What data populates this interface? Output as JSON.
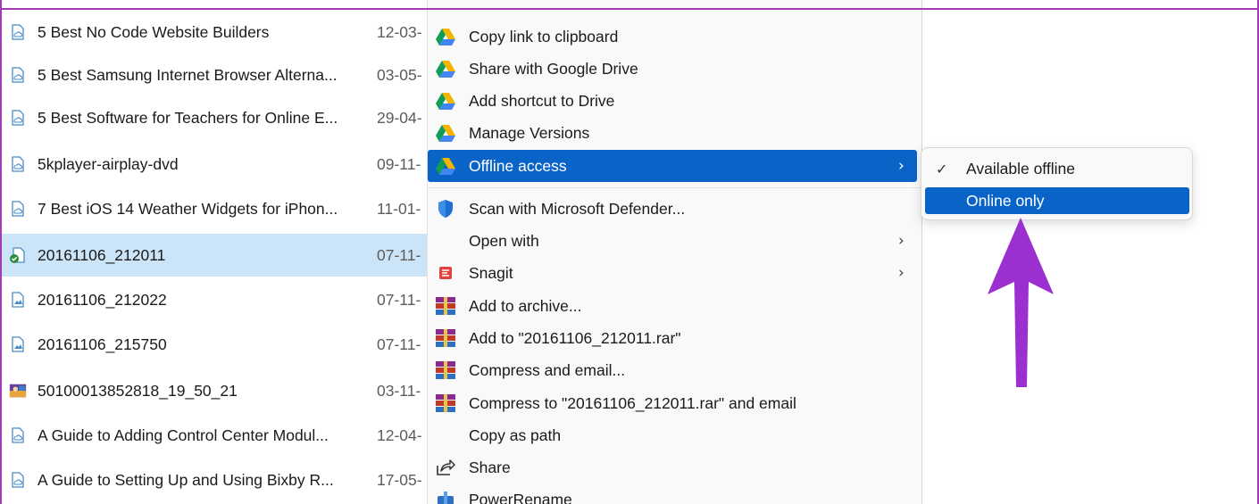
{
  "files": [
    {
      "name": "5 Best No Code Website Builders",
      "date": "12-03-",
      "icon": "cloud-doc-icon",
      "selected": false
    },
    {
      "name": "5 Best Samsung Internet Browser Alterna...",
      "date": "03-05-",
      "icon": "cloud-doc-icon",
      "selected": false
    },
    {
      "name": "5 Best Software for Teachers for Online E...",
      "date": "29-04-",
      "icon": "cloud-doc-icon",
      "selected": false
    },
    {
      "name": "5kplayer-airplay-dvd",
      "date": "09-11-",
      "icon": "cloud-doc-icon",
      "selected": false
    },
    {
      "name": "7 Best iOS 14 Weather Widgets for iPhon...",
      "date": "11-01-",
      "icon": "cloud-doc-icon",
      "selected": false
    },
    {
      "name": "20161106_212011",
      "date": "07-11-",
      "icon": "synced-image-icon",
      "selected": true
    },
    {
      "name": "20161106_212022",
      "date": "07-11-",
      "icon": "image-doc-icon",
      "selected": false
    },
    {
      "name": "20161106_215750",
      "date": "07-11-",
      "icon": "image-doc-icon",
      "selected": false
    },
    {
      "name": "50100013852818_19_50_21",
      "date": "03-11-",
      "icon": "photo-thumbnail-icon",
      "selected": false
    },
    {
      "name": "A Guide to Adding Control Center Modul...",
      "date": "12-04-",
      "icon": "cloud-doc-icon",
      "selected": false
    },
    {
      "name": "A Guide to Setting Up and Using Bixby R...",
      "date": "17-05-",
      "icon": "cloud-doc-icon",
      "selected": false
    }
  ],
  "menu": {
    "items": [
      {
        "label": "Copy link to clipboard",
        "icon": "google-drive-icon"
      },
      {
        "label": "Share with Google Drive",
        "icon": "google-drive-icon"
      },
      {
        "label": "Add shortcut to Drive",
        "icon": "google-drive-icon"
      },
      {
        "label": "Manage Versions",
        "icon": "google-drive-icon"
      },
      {
        "label": "Offline access",
        "icon": "google-drive-icon",
        "submenu": true,
        "highlighted": true
      },
      {
        "label": "Scan with Microsoft Defender...",
        "icon": "defender-shield-icon"
      },
      {
        "label": "Open with",
        "icon": "",
        "submenu": true
      },
      {
        "label": "Snagit",
        "icon": "snagit-icon",
        "submenu": true
      },
      {
        "label": "Add to archive...",
        "icon": "winrar-icon"
      },
      {
        "label": "Add to \"20161106_212011.rar\"",
        "icon": "winrar-icon"
      },
      {
        "label": "Compress and email...",
        "icon": "winrar-icon"
      },
      {
        "label": "Compress to \"20161106_212011.rar\" and email",
        "icon": "winrar-icon"
      },
      {
        "label": "Copy as path",
        "icon": ""
      },
      {
        "label": "Share",
        "icon": "share-icon"
      },
      {
        "label": "PowerRename",
        "icon": "powerrename-icon"
      }
    ]
  },
  "submenu": {
    "items": [
      {
        "label": "Available offline",
        "checked": true,
        "highlighted": false
      },
      {
        "label": "Online only",
        "checked": false,
        "highlighted": true
      }
    ]
  },
  "colors": {
    "selection": "#cce4f7",
    "menu_highlight": "#0a64c8",
    "annotation_arrow": "#9b2fd0",
    "frame": "#a53ab8"
  }
}
